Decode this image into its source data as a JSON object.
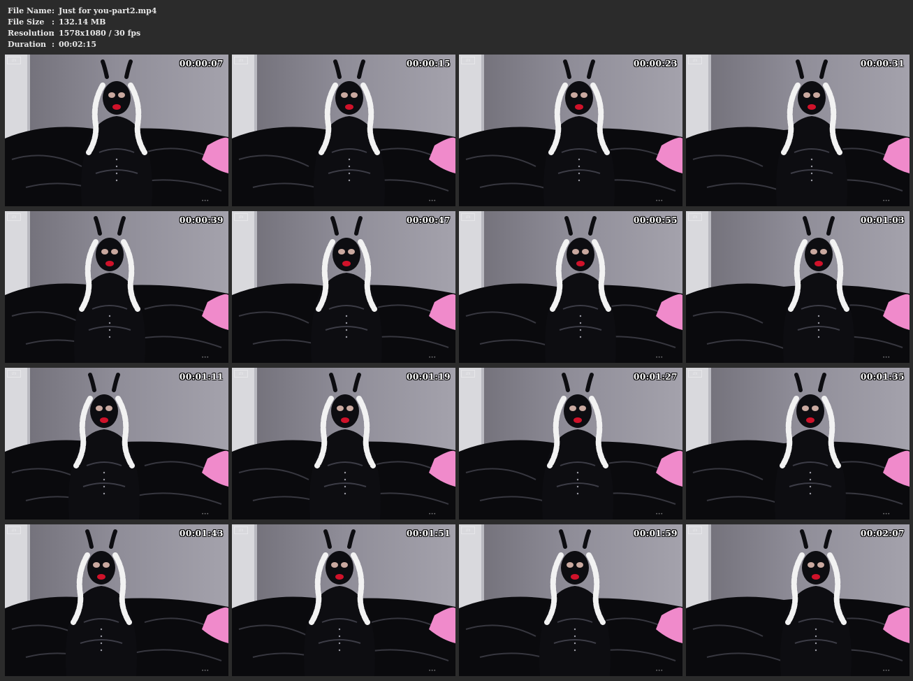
{
  "info": {
    "rows": [
      {
        "label": "File Name",
        "sep": ":",
        "value": "Just for you-part2.mp4"
      },
      {
        "label": "File Size",
        "sep": ":",
        "value": "132.14 MB"
      },
      {
        "label": "Resolution",
        "sep": ":",
        "value": "1578x1080 / 30 fps"
      },
      {
        "label": "Duration",
        "sep": ":",
        "value": "00:02:15"
      }
    ]
  },
  "thumbnails": [
    {
      "timestamp": "00:00:07"
    },
    {
      "timestamp": "00:00:15"
    },
    {
      "timestamp": "00:00:23"
    },
    {
      "timestamp": "00:00:31"
    },
    {
      "timestamp": "00:00:39"
    },
    {
      "timestamp": "00:00:47"
    },
    {
      "timestamp": "00:00:55"
    },
    {
      "timestamp": "00:01:03"
    },
    {
      "timestamp": "00:01:11"
    },
    {
      "timestamp": "00:01:19"
    },
    {
      "timestamp": "00:01:27"
    },
    {
      "timestamp": "00:01:35"
    },
    {
      "timestamp": "00:01:43"
    },
    {
      "timestamp": "00:01:51"
    },
    {
      "timestamp": "00:01:59"
    },
    {
      "timestamp": "00:02:07"
    }
  ],
  "colors": {
    "background": "#2b2b2b",
    "wall": "#8a8894",
    "latex": "#0b0b0e",
    "braids": "#f2f2f2",
    "pillow": "#f08acb"
  }
}
